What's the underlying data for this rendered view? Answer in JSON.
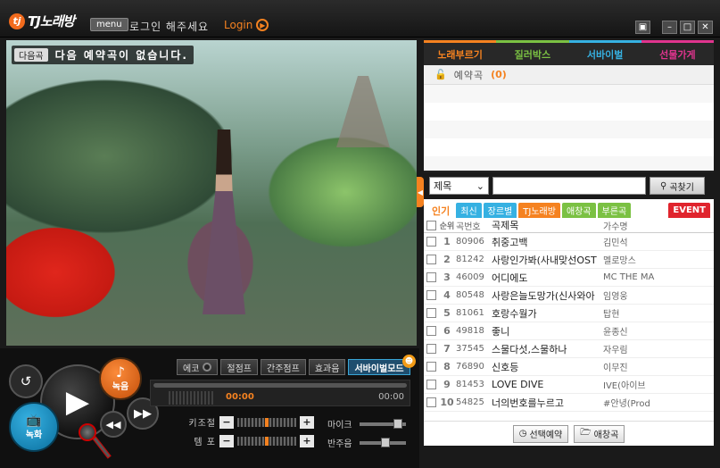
{
  "app": {
    "logo_badge": "tj",
    "logo_text": "TJ노래방",
    "menu_label": "menu",
    "login_prompt": "로그인 해주세요",
    "login_link": "Login"
  },
  "window_buttons": [
    "fullscreen-icon",
    "minimize-icon",
    "maximize-icon",
    "close-icon"
  ],
  "video": {
    "next_label": "다음곡",
    "next_message": "다음 예약곡이 없습니다."
  },
  "controls": {
    "record_label": "녹음",
    "video_label": "녹화",
    "mode_buttons": [
      {
        "label": "에코",
        "has_toggle": true
      },
      {
        "label": "절점프"
      },
      {
        "label": "간주점프"
      },
      {
        "label": "효과음"
      },
      {
        "label": "서바이벌모드",
        "active": true
      }
    ],
    "time_current": "00:00",
    "time_total": "00:00",
    "progress": 0,
    "key_label": "키조절",
    "tempo_label": "템 포",
    "mic_label": "마이크",
    "accompaniment_label": "반주음",
    "accent_color": "#f58220"
  },
  "right_panel": {
    "tabs": [
      "노래부르기",
      "질러박스",
      "서바이벌",
      "선물가게"
    ],
    "tab_colors": [
      "#f58220",
      "#7bc143",
      "#36b1e2",
      "#e0348e"
    ],
    "queue_label": "예약곡",
    "queue_count": "(0)",
    "search": {
      "field_selected": "제목",
      "button_label": "곡찾기"
    },
    "filters": [
      "인기",
      "최신",
      "장르별",
      "TJ노래방",
      "애창곡",
      "부른곡",
      "EVENT"
    ],
    "columns": {
      "rank": "순위",
      "num": "곡번호",
      "title": "곡제목",
      "artist": "가수명"
    },
    "songs": [
      {
        "rank": "1",
        "num": "80906",
        "title": "취중고백",
        "artist": "김민석"
      },
      {
        "rank": "2",
        "num": "81242",
        "title": "사랑인가봐(사내맞선OST",
        "artist": "멜로망스"
      },
      {
        "rank": "3",
        "num": "46009",
        "title": "어디에도",
        "artist": "MC THE MA"
      },
      {
        "rank": "4",
        "num": "80548",
        "title": "사랑은늘도망가(신사와아",
        "artist": "임영웅"
      },
      {
        "rank": "5",
        "num": "81061",
        "title": "호랑수월가",
        "artist": "탑현"
      },
      {
        "rank": "6",
        "num": "49818",
        "title": "좋니",
        "artist": "윤종신"
      },
      {
        "rank": "7",
        "num": "37545",
        "title": "스물다섯,스물하나",
        "artist": "자우림"
      },
      {
        "rank": "8",
        "num": "76890",
        "title": "신호등",
        "artist": "이무진"
      },
      {
        "rank": "9",
        "num": "81453",
        "title": "LOVE DIVE",
        "artist": "IVE(아이브"
      },
      {
        "rank": "10",
        "num": "54825",
        "title": "너의번호를누르고",
        "artist": "#안녕(Prod"
      }
    ],
    "reserve_button": "선택예약",
    "favorite_button": "애창곡"
  }
}
